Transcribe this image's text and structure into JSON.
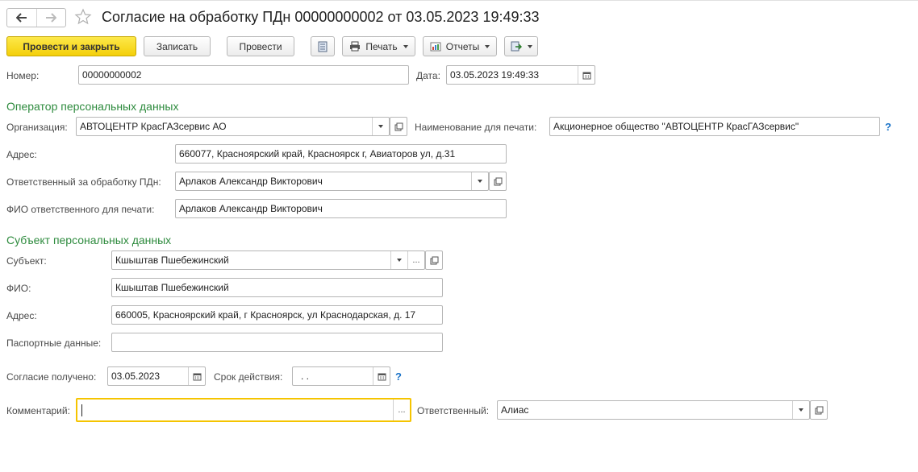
{
  "header": {
    "title": "Согласие на обработку ПДн 00000000002 от 03.05.2023 19:49:33"
  },
  "toolbar": {
    "post_and_close": "Провести и закрыть",
    "save": "Записать",
    "post": "Провести",
    "print": "Печать",
    "reports": "Отчеты"
  },
  "form": {
    "number_label": "Номер:",
    "number_value": "00000000002",
    "date_label": "Дата:",
    "date_value": "03.05.2023 19:49:33",
    "operator_section": "Оператор персональных данных",
    "org_label": "Организация:",
    "org_value": "АВТОЦЕНТР КрасГАЗсервис АО",
    "print_name_label": "Наименование для печати:",
    "print_name_value": "Акционерное общество \"АВТОЦЕНТР КрасГАЗсервис\"",
    "address_label": "Адрес:",
    "address_value": "660077, Красноярский край, Красноярск г, Авиаторов ул, д.31",
    "responsible_pd_label": "Ответственный за обработку ПДн:",
    "responsible_pd_value": "Арлаков Александр Викторович",
    "responsible_print_label": "ФИО ответственного для печати:",
    "responsible_print_value": "Арлаков Александр Викторович",
    "subject_section": "Субъект персональных данных",
    "subject_label": "Субъект:",
    "subject_value": "Кшыштав Пшебежинский",
    "fio_label": "ФИО:",
    "fio_value": "Кшыштав Пшебежинский",
    "subject_address_label": "Адрес:",
    "subject_address_value": "660005, Красноярский край, г Красноярск, ул Краснодарская, д. 17",
    "passport_label": "Паспортные данные:",
    "passport_value": "",
    "consent_label": "Согласие получено:",
    "consent_value": "03.05.2023",
    "term_label": "Срок действия:",
    "term_value": " .  .",
    "comment_label": "Комментарий:",
    "comment_value": "",
    "responsible_label": "Ответственный:",
    "responsible_value": "Алиас",
    "help_mark": "?",
    "ellipsis": "..."
  }
}
